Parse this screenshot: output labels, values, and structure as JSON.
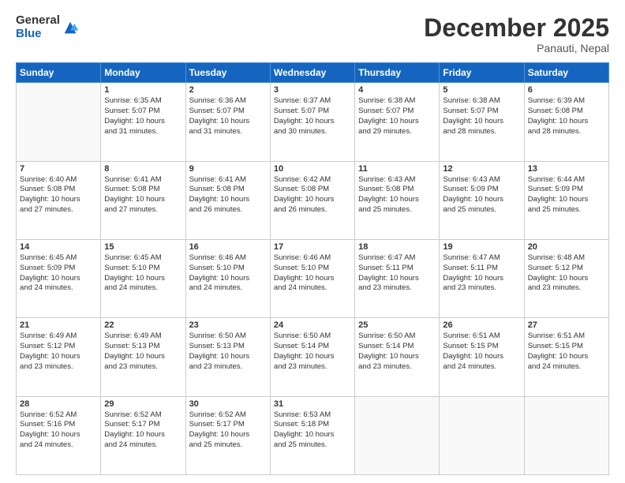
{
  "logo": {
    "general": "General",
    "blue": "Blue"
  },
  "title": "December 2025",
  "location": "Panauti, Nepal",
  "weekdays": [
    "Sunday",
    "Monday",
    "Tuesday",
    "Wednesday",
    "Thursday",
    "Friday",
    "Saturday"
  ],
  "weeks": [
    [
      {
        "day": "",
        "info": ""
      },
      {
        "day": "1",
        "info": "Sunrise: 6:35 AM\nSunset: 5:07 PM\nDaylight: 10 hours\nand 31 minutes."
      },
      {
        "day": "2",
        "info": "Sunrise: 6:36 AM\nSunset: 5:07 PM\nDaylight: 10 hours\nand 31 minutes."
      },
      {
        "day": "3",
        "info": "Sunrise: 6:37 AM\nSunset: 5:07 PM\nDaylight: 10 hours\nand 30 minutes."
      },
      {
        "day": "4",
        "info": "Sunrise: 6:38 AM\nSunset: 5:07 PM\nDaylight: 10 hours\nand 29 minutes."
      },
      {
        "day": "5",
        "info": "Sunrise: 6:38 AM\nSunset: 5:07 PM\nDaylight: 10 hours\nand 28 minutes."
      },
      {
        "day": "6",
        "info": "Sunrise: 6:39 AM\nSunset: 5:08 PM\nDaylight: 10 hours\nand 28 minutes."
      }
    ],
    [
      {
        "day": "7",
        "info": "Sunrise: 6:40 AM\nSunset: 5:08 PM\nDaylight: 10 hours\nand 27 minutes."
      },
      {
        "day": "8",
        "info": "Sunrise: 6:41 AM\nSunset: 5:08 PM\nDaylight: 10 hours\nand 27 minutes."
      },
      {
        "day": "9",
        "info": "Sunrise: 6:41 AM\nSunset: 5:08 PM\nDaylight: 10 hours\nand 26 minutes."
      },
      {
        "day": "10",
        "info": "Sunrise: 6:42 AM\nSunset: 5:08 PM\nDaylight: 10 hours\nand 26 minutes."
      },
      {
        "day": "11",
        "info": "Sunrise: 6:43 AM\nSunset: 5:08 PM\nDaylight: 10 hours\nand 25 minutes."
      },
      {
        "day": "12",
        "info": "Sunrise: 6:43 AM\nSunset: 5:09 PM\nDaylight: 10 hours\nand 25 minutes."
      },
      {
        "day": "13",
        "info": "Sunrise: 6:44 AM\nSunset: 5:09 PM\nDaylight: 10 hours\nand 25 minutes."
      }
    ],
    [
      {
        "day": "14",
        "info": "Sunrise: 6:45 AM\nSunset: 5:09 PM\nDaylight: 10 hours\nand 24 minutes."
      },
      {
        "day": "15",
        "info": "Sunrise: 6:45 AM\nSunset: 5:10 PM\nDaylight: 10 hours\nand 24 minutes."
      },
      {
        "day": "16",
        "info": "Sunrise: 6:46 AM\nSunset: 5:10 PM\nDaylight: 10 hours\nand 24 minutes."
      },
      {
        "day": "17",
        "info": "Sunrise: 6:46 AM\nSunset: 5:10 PM\nDaylight: 10 hours\nand 24 minutes."
      },
      {
        "day": "18",
        "info": "Sunrise: 6:47 AM\nSunset: 5:11 PM\nDaylight: 10 hours\nand 23 minutes."
      },
      {
        "day": "19",
        "info": "Sunrise: 6:47 AM\nSunset: 5:11 PM\nDaylight: 10 hours\nand 23 minutes."
      },
      {
        "day": "20",
        "info": "Sunrise: 6:48 AM\nSunset: 5:12 PM\nDaylight: 10 hours\nand 23 minutes."
      }
    ],
    [
      {
        "day": "21",
        "info": "Sunrise: 6:49 AM\nSunset: 5:12 PM\nDaylight: 10 hours\nand 23 minutes."
      },
      {
        "day": "22",
        "info": "Sunrise: 6:49 AM\nSunset: 5:13 PM\nDaylight: 10 hours\nand 23 minutes."
      },
      {
        "day": "23",
        "info": "Sunrise: 6:50 AM\nSunset: 5:13 PM\nDaylight: 10 hours\nand 23 minutes."
      },
      {
        "day": "24",
        "info": "Sunrise: 6:50 AM\nSunset: 5:14 PM\nDaylight: 10 hours\nand 23 minutes."
      },
      {
        "day": "25",
        "info": "Sunrise: 6:50 AM\nSunset: 5:14 PM\nDaylight: 10 hours\nand 23 minutes."
      },
      {
        "day": "26",
        "info": "Sunrise: 6:51 AM\nSunset: 5:15 PM\nDaylight: 10 hours\nand 24 minutes."
      },
      {
        "day": "27",
        "info": "Sunrise: 6:51 AM\nSunset: 5:15 PM\nDaylight: 10 hours\nand 24 minutes."
      }
    ],
    [
      {
        "day": "28",
        "info": "Sunrise: 6:52 AM\nSunset: 5:16 PM\nDaylight: 10 hours\nand 24 minutes."
      },
      {
        "day": "29",
        "info": "Sunrise: 6:52 AM\nSunset: 5:17 PM\nDaylight: 10 hours\nand 24 minutes."
      },
      {
        "day": "30",
        "info": "Sunrise: 6:52 AM\nSunset: 5:17 PM\nDaylight: 10 hours\nand 25 minutes."
      },
      {
        "day": "31",
        "info": "Sunrise: 6:53 AM\nSunset: 5:18 PM\nDaylight: 10 hours\nand 25 minutes."
      },
      {
        "day": "",
        "info": ""
      },
      {
        "day": "",
        "info": ""
      },
      {
        "day": "",
        "info": ""
      }
    ]
  ]
}
